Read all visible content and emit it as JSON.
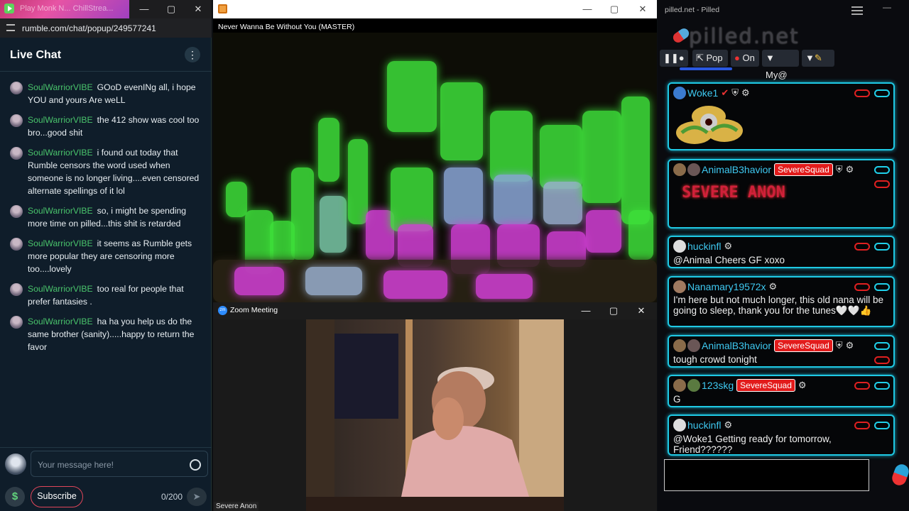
{
  "rumble": {
    "tab_title": "Play Monk N... ChillStrea...",
    "address": "rumble.com/chat/popup/249577241",
    "header_title": "Live Chat",
    "messages": [
      {
        "user": "SoulWarriorVIBE",
        "text": "GOoD evenINg all, i hope YOU and yours Are weLL"
      },
      {
        "user": "SoulWarriorVIBE",
        "text": "the 412 show was cool too bro...good shit"
      },
      {
        "user": "SoulWarriorVIBE",
        "text": "i found out today that Rumble censors the word used when someone is no longer living....even censored alternate spellings of it lol"
      },
      {
        "user": "SoulWarriorVIBE",
        "text": "so, i might be spending more time on pilled...this shit is retarded"
      },
      {
        "user": "SoulWarriorVIBE",
        "text": "it seems as Rumble gets more popular they are censoring more too....lovely"
      },
      {
        "user": "SoulWarriorVIBE",
        "text": "too real for people that prefer fantasies ."
      },
      {
        "user": "SoulWarriorVIBE",
        "text": "ha ha you help us do the same brother (sanity).....happy to return the favor"
      }
    ],
    "input_placeholder": "Your message here!",
    "dollar_icon": "$",
    "subscribe_label": "Subscribe",
    "char_count": "0/200"
  },
  "video": {
    "song_title": "Never Wanna Be Without You (MASTER)"
  },
  "zoom": {
    "window_title": "Zoom Meeting",
    "participant_name": "Severe Anon"
  },
  "pilled": {
    "window_title": "pilled.net - Pilled",
    "logo_text": "pilled.net",
    "toolbar": {
      "pop_label": "Pop",
      "on_label": "On",
      "my_label": "My@"
    },
    "cards": [
      {
        "user": "Woke1",
        "badge": "",
        "text": ""
      },
      {
        "user": "AnimalB3havior",
        "badge": "SevereSquad",
        "text": "SEVERE ANON"
      },
      {
        "user": "huckinfl",
        "badge": "",
        "text": "@Animal Cheers GF xoxo"
      },
      {
        "user": "Nanamary19572x",
        "badge": "",
        "text": "I'm here but not much longer, this old nana will be going to sleep, thank you for the tunes🤍🤍👍"
      },
      {
        "user": "AnimalB3havior",
        "badge": "SevereSquad",
        "text": "tough crowd tonight"
      },
      {
        "user": "123skg",
        "badge": "SevereSquad",
        "text": "G"
      },
      {
        "user": "huckinfl",
        "badge": "",
        "text": "@Woke1 Getting ready for tomorrow, Friend??????"
      }
    ]
  },
  "colors": {
    "rumble_username": "#49c36b",
    "pilled_border": "#1fc9e4",
    "pilled_badge": "#e21b1b",
    "visual_green": "#3ee03a",
    "visual_magenta": "#d33fd6"
  }
}
